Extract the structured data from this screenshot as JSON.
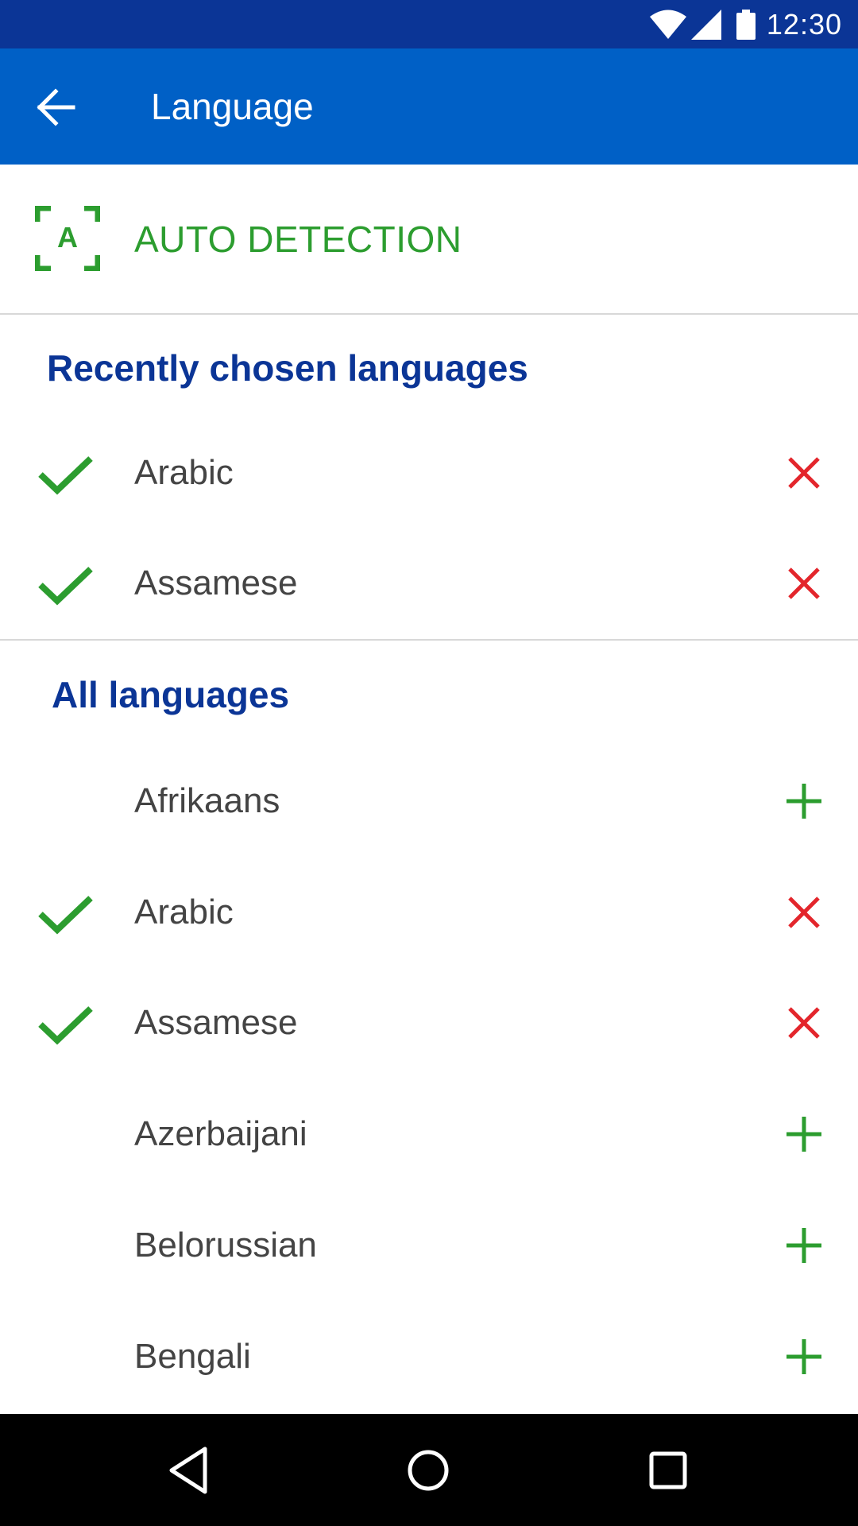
{
  "status_bar": {
    "time": "12:30",
    "icons": [
      "wifi-icon",
      "cellular-signal-icon",
      "battery-icon"
    ]
  },
  "app_bar": {
    "title": "Language",
    "back_icon": "arrow-back-icon",
    "background_color": "#0060c6"
  },
  "auto_detection": {
    "label": "AUTO DETECTION",
    "icon": "auto-detect-icon",
    "icon_letter": "A",
    "color": "#2c9d2f"
  },
  "recent": {
    "heading": "Recently chosen languages",
    "items": [
      {
        "name": "Arabic",
        "selected": true,
        "action": "remove"
      },
      {
        "name": "Assamese",
        "selected": true,
        "action": "remove"
      }
    ]
  },
  "all": {
    "heading": "All languages",
    "items": [
      {
        "name": "Afrikaans",
        "selected": false,
        "action": "add"
      },
      {
        "name": "Arabic",
        "selected": true,
        "action": "remove"
      },
      {
        "name": "Assamese",
        "selected": true,
        "action": "remove"
      },
      {
        "name": "Azerbaijani",
        "selected": false,
        "action": "add"
      },
      {
        "name": "Belorussian",
        "selected": false,
        "action": "add"
      },
      {
        "name": "Bengali",
        "selected": false,
        "action": "add"
      }
    ]
  },
  "colors": {
    "status_bar": "#0b3596",
    "heading": "#0b3596",
    "check": "#2c9d2f",
    "remove": "#e3262c",
    "add": "#2c9d2f"
  },
  "nav_bar": {
    "buttons": [
      "back-triangle-icon",
      "home-circle-icon",
      "recents-square-icon"
    ]
  }
}
